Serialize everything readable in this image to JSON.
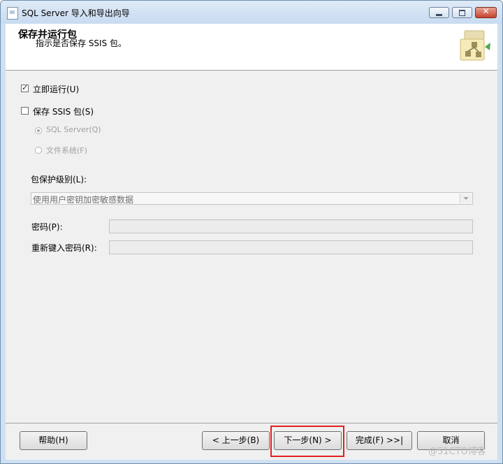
{
  "window": {
    "title": "SQL Server 导入和导出向导"
  },
  "header": {
    "title": "保存并运行包",
    "subtitle": "指示是否保存 SSIS 包。"
  },
  "options": {
    "run_immediately": {
      "label": "立即运行(U)",
      "checked": true
    },
    "save_ssis": {
      "label": "保存 SSIS 包(S)",
      "checked": false
    },
    "sql_server": {
      "label": "SQL Server(Q)",
      "selected": true
    },
    "file_system": {
      "label": "文件系统(F)",
      "selected": false
    }
  },
  "protection": {
    "label": "包保护级别(L):",
    "value": "使用用户密钥加密敏感数据"
  },
  "password": {
    "label": "密码(P):",
    "value": ""
  },
  "retype_password": {
    "label": "重新键入密码(R):",
    "value": ""
  },
  "buttons": {
    "help": "帮助(H)",
    "back": "< 上一步(B)",
    "next": "下一步(N) >",
    "finish": "完成(F) >>|",
    "cancel": "取消"
  },
  "watermark": "@51CTO博客"
}
